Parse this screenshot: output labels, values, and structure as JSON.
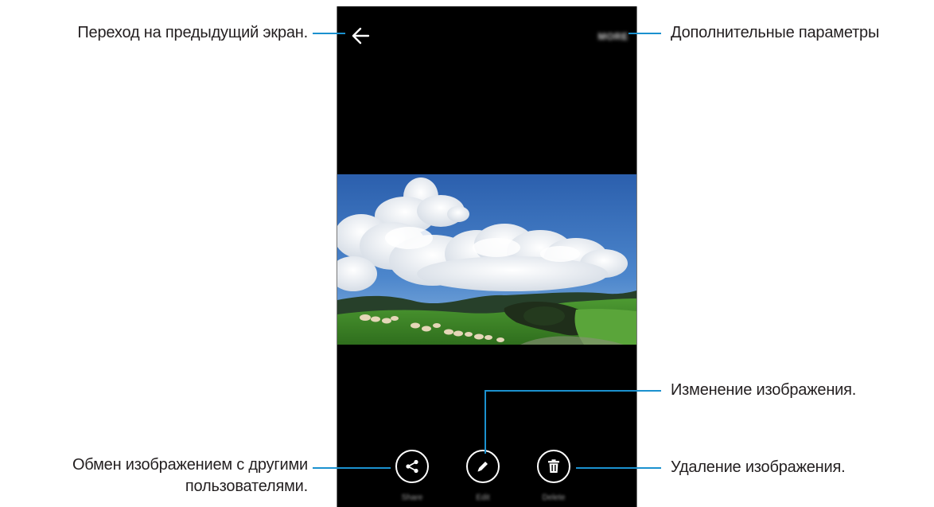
{
  "callouts": {
    "back": "Переход на предыдущий экран.",
    "more": "Дополнительные параметры",
    "edit": "Изменение изображения.",
    "share_line1": "Обмен изображением с другими",
    "share_line2": "пользователями.",
    "delete": "Удаление изображения."
  },
  "screen": {
    "more_label": "MORE",
    "toolbar": {
      "share_label": "Share",
      "edit_label": "Edit",
      "delete_label": "Delete"
    }
  },
  "icons": {
    "back": "arrow-left-icon",
    "share": "share-icon",
    "edit": "pencil-icon",
    "delete": "trash-icon"
  },
  "colors": {
    "callout_line": "#1b91cf",
    "screen_background": "#000000",
    "text": "#231f20"
  }
}
